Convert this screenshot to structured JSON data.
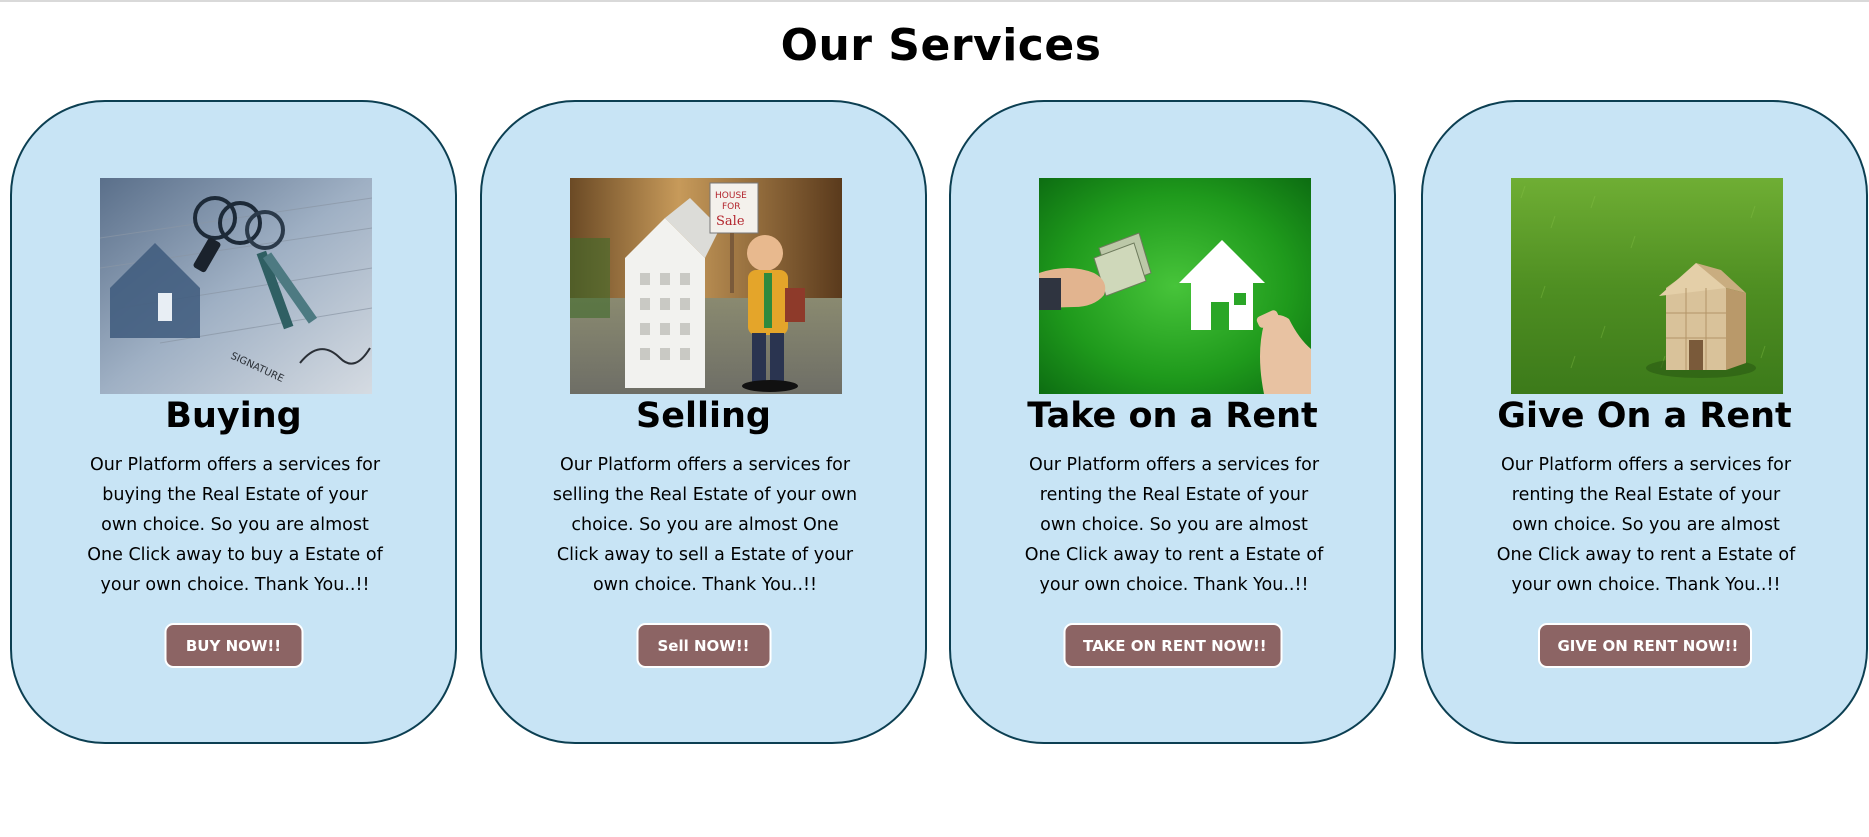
{
  "page": {
    "title": "Our Services"
  },
  "colors": {
    "card_bg": "#c8e4f5",
    "card_border": "#0c3f52",
    "button_bg": "#8c6464",
    "button_text": "#ffffff"
  },
  "services": [
    {
      "title": "Buying",
      "description": "Our Platform offers a services for buying the Real Estate of your own choice. So you are almost One Click away to buy a Estate of your own choice. Thank You..!!",
      "button_label": "BUY NOW!!",
      "image_icon": "keys-on-contract-image"
    },
    {
      "title": "Selling",
      "description": "Our Platform offers a services for selling the Real Estate of your own choice. So you are almost One Click away to sell a Estate of your own choice. Thank You..!!",
      "button_label": "Sell NOW!!",
      "image_icon": "house-for-sale-figurine-image",
      "sign_text": "HOUSE FOR Sale"
    },
    {
      "title": "Take on a Rent",
      "description": "Our Platform offers a services for renting the Real Estate of your own choice. So you are almost One Click away to rent a Estate of your own choice. Thank You..!!",
      "button_label": "TAKE ON RENT NOW!!",
      "image_icon": "money-for-house-image"
    },
    {
      "title": "Give On a Rent",
      "description": "Our Platform offers a services for renting the Real Estate of your own choice. So you are almost One Click away to rent a Estate of your own choice. Thank You..!!",
      "button_label": "GIVE ON RENT NOW!!",
      "image_icon": "wooden-house-on-grass-image"
    }
  ]
}
